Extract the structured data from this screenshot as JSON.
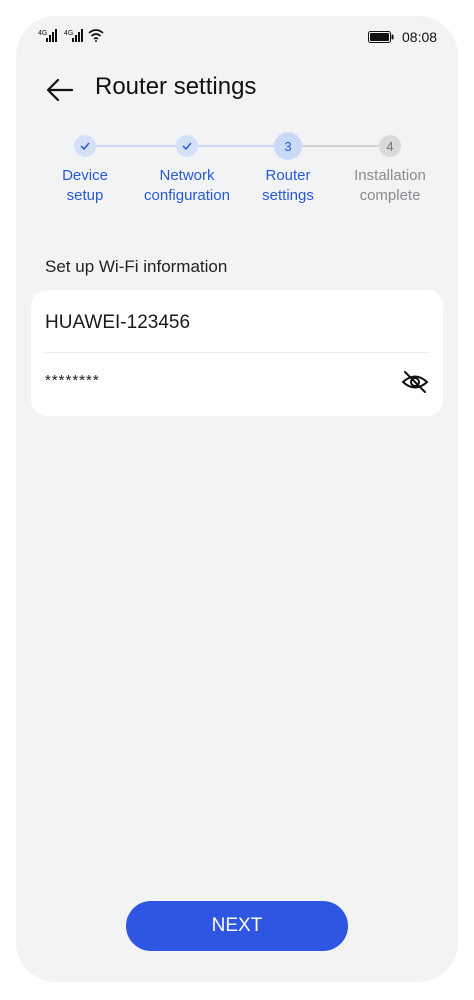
{
  "status_bar": {
    "time": "08:08",
    "signal_1_label": "4G",
    "signal_2_label": "4G"
  },
  "header": {
    "title": "Router settings"
  },
  "steps": [
    {
      "label_line1": "Device",
      "label_line2": "setup",
      "state": "done",
      "number": ""
    },
    {
      "label_line1": "Network",
      "label_line2": "configuration",
      "state": "done",
      "number": ""
    },
    {
      "label_line1": "Router",
      "label_line2": "settings",
      "state": "active",
      "number": "3"
    },
    {
      "label_line1": "Installation",
      "label_line2": "complete",
      "state": "todo",
      "number": "4"
    }
  ],
  "wifi_form": {
    "section_title": "Set up Wi-Fi information",
    "ssid": "HUAWEI-123456",
    "password_masked": "********"
  },
  "footer": {
    "next_label": "NEXT"
  },
  "colors": {
    "accent": "#2f55e3",
    "active_text": "#2a59d8",
    "background": "#f1f3f5"
  }
}
